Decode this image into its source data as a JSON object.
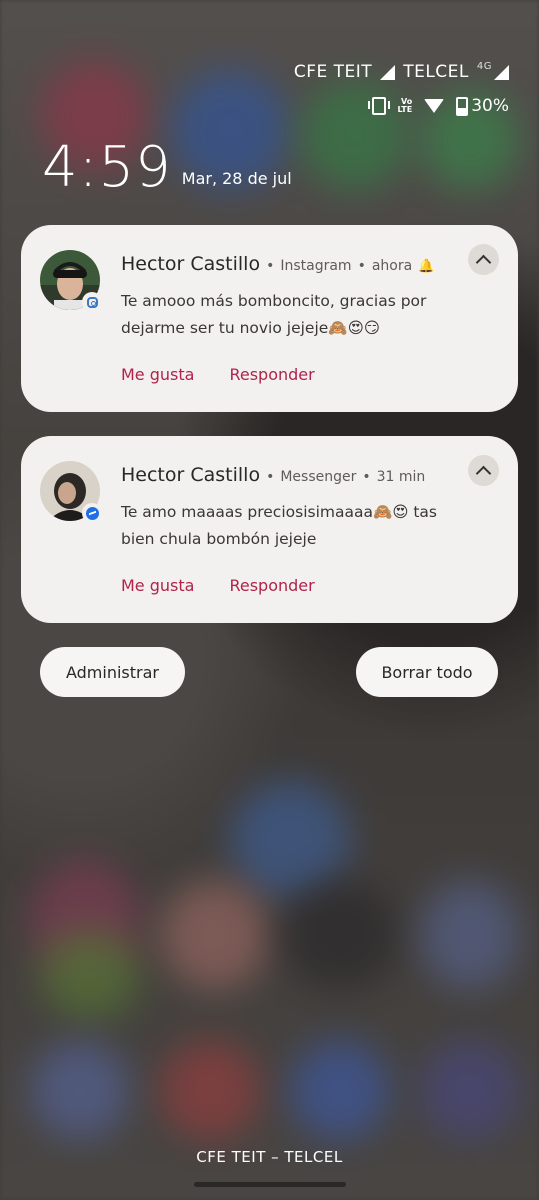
{
  "status_bar": {
    "carrier1": "CFE TEIT",
    "carrier2": "TELCEL",
    "network": "4G",
    "volte": "Vo\nLTE",
    "battery": "30%"
  },
  "lockscreen": {
    "time": "4:59",
    "date": "Mar, 28 de jul"
  },
  "notifications": [
    {
      "sender": "Hector Castillo",
      "app": "Instagram",
      "when": "ahora",
      "message": "Te amooo más bomboncito, gracias por dejarme ser tu novio jejeje🙈😍😏",
      "action1": "Me gusta",
      "action2": "Responder"
    },
    {
      "sender": "Hector Castillo",
      "app": "Messenger",
      "when": "31 min",
      "message": "Te amo maaaas preciosisimaaaa🙈😍 tas bien chula bombón jejeje",
      "action1": "Me gusta",
      "action2": "Responder"
    }
  ],
  "buttons": {
    "manage": "Administrar",
    "clear_all": "Borrar todo"
  },
  "footer": {
    "carrier_label": "CFE TEIT – TELCEL"
  },
  "colors": {
    "accent": "#b0234a",
    "card_bg": "#f3f1ef"
  }
}
